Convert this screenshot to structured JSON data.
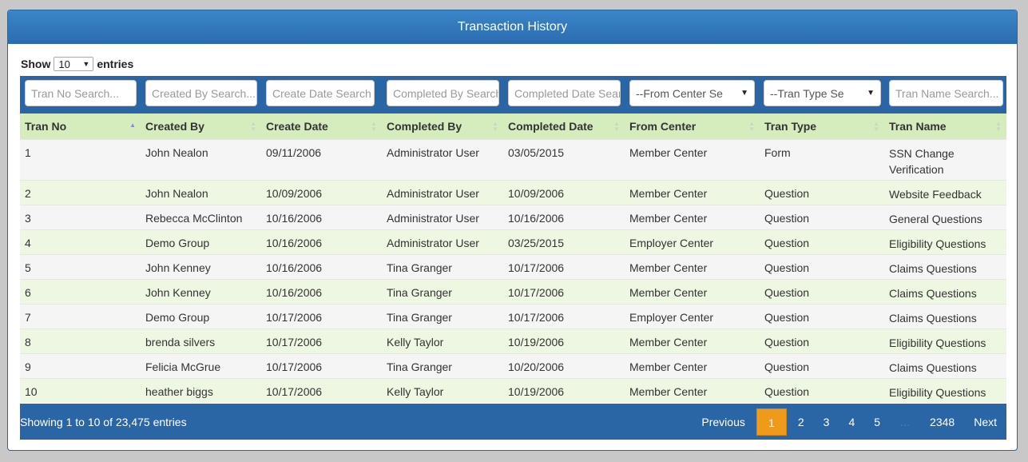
{
  "panel": {
    "title": "Transaction History"
  },
  "length": {
    "show_label": "Show",
    "value": "10",
    "entries_label": "entries"
  },
  "filters": [
    {
      "placeholder": "Tran No Search..."
    },
    {
      "placeholder": "Created By Search..."
    },
    {
      "placeholder": "Create Date Search"
    },
    {
      "placeholder": "Completed By Search"
    },
    {
      "placeholder": "Completed Date Search"
    },
    {
      "selected": "--From Center Se"
    },
    {
      "selected": "--Tran Type Se"
    },
    {
      "placeholder": "Tran Name Search..."
    }
  ],
  "columns": [
    "Tran No",
    "Created By",
    "Create Date",
    "Completed By",
    "Completed Date",
    "From Center",
    "Tran Type",
    "Tran Name"
  ],
  "rows": [
    [
      "1",
      "John Nealon",
      "09/11/2006",
      "Administrator User",
      "03/05/2015",
      "Member Center",
      "Form",
      "SSN Change Verification"
    ],
    [
      "2",
      "John Nealon",
      "10/09/2006",
      "Administrator User",
      "10/09/2006",
      "Member Center",
      "Question",
      "Website Feedback"
    ],
    [
      "3",
      "Rebecca McClinton",
      "10/16/2006",
      "Administrator User",
      "10/16/2006",
      "Member Center",
      "Question",
      "General Questions"
    ],
    [
      "4",
      "Demo Group",
      "10/16/2006",
      "Administrator User",
      "03/25/2015",
      "Employer Center",
      "Question",
      "Eligibility Questions"
    ],
    [
      "5",
      "John Kenney",
      "10/16/2006",
      "Tina Granger",
      "10/17/2006",
      "Member Center",
      "Question",
      "Claims Questions"
    ],
    [
      "6",
      "John Kenney",
      "10/16/2006",
      "Tina Granger",
      "10/17/2006",
      "Member Center",
      "Question",
      "Claims Questions"
    ],
    [
      "7",
      "Demo Group",
      "10/17/2006",
      "Tina Granger",
      "10/17/2006",
      "Employer Center",
      "Question",
      "Claims Questions"
    ],
    [
      "8",
      "brenda silvers",
      "10/17/2006",
      "Kelly Taylor",
      "10/19/2006",
      "Member Center",
      "Question",
      "Eligibility Questions"
    ],
    [
      "9",
      "Felicia McGrue",
      "10/17/2006",
      "Tina Granger",
      "10/20/2006",
      "Member Center",
      "Question",
      "Claims Questions"
    ],
    [
      "10",
      "heather biggs",
      "10/17/2006",
      "Kelly Taylor",
      "10/19/2006",
      "Member Center",
      "Question",
      "Eligibility Questions"
    ]
  ],
  "footer": {
    "info": "Showing 1 to 10 of 23,475 entries",
    "previous": "Previous",
    "pages": [
      "1",
      "2",
      "3",
      "4",
      "5"
    ],
    "ellipsis": "…",
    "last_page": "2348",
    "next": "Next",
    "current_page": "1"
  },
  "colors": {
    "header_blue": "#2a66a6",
    "header_row_green": "#d5ecbd",
    "current_page_orange": "#ef9a1a"
  },
  "icons": {
    "sort_active": "sort-asc-icon",
    "sort_inactive": "sort-both-icon",
    "select_arrow": "caret-down-icon"
  }
}
